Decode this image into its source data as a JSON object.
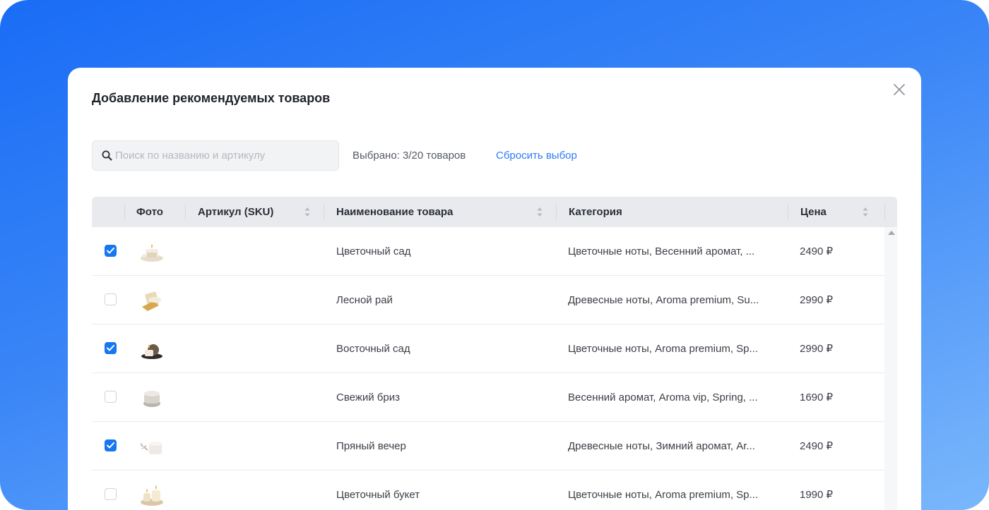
{
  "modal": {
    "title": "Добавление рекомендуемых товаров"
  },
  "search": {
    "placeholder": "Поиск по названию и артикулу",
    "value": ""
  },
  "selection": {
    "summary": "Выбрано: 3/20 товаров",
    "reset_label": "Сбросить выбор"
  },
  "table": {
    "headers": {
      "photo": "Фото",
      "sku": "Артикул (SKU)",
      "name": "Наименование товара",
      "category": "Категория",
      "price": "Цена"
    },
    "rows": [
      {
        "checked": true,
        "sku": "",
        "name": "Цветочный сад",
        "category": "Цветочные ноты, Весенний аромат, ...",
        "price": "2490 ₽"
      },
      {
        "checked": false,
        "sku": "",
        "name": "Лесной рай",
        "category": "Древесные ноты, Aroma premium, Su...",
        "price": "2990 ₽"
      },
      {
        "checked": true,
        "sku": "",
        "name": "Восточный сад",
        "category": "Цветочные ноты, Aroma premium, Sp...",
        "price": "2990 ₽"
      },
      {
        "checked": false,
        "sku": "",
        "name": "Свежий бриз",
        "category": "Весенний аромат, Aroma vip, Spring, ...",
        "price": "1690 ₽"
      },
      {
        "checked": true,
        "sku": "",
        "name": "Пряный вечер",
        "category": "Древесные ноты, Зимний аромат, Ar...",
        "price": "2490 ₽"
      },
      {
        "checked": false,
        "sku": "",
        "name": "Цветочный букет",
        "category": "Цветочные ноты, Aroma premium, Sp...",
        "price": "1990 ₽"
      }
    ]
  },
  "colors": {
    "accent": "#1677f2",
    "link": "#2d7cf3",
    "background_gradient_start": "#1a6cf5",
    "background_gradient_end": "#7ab7fb"
  },
  "icons": {
    "close": "close-icon",
    "search": "search-icon",
    "sort": "sort-icon",
    "check": "check-icon"
  }
}
